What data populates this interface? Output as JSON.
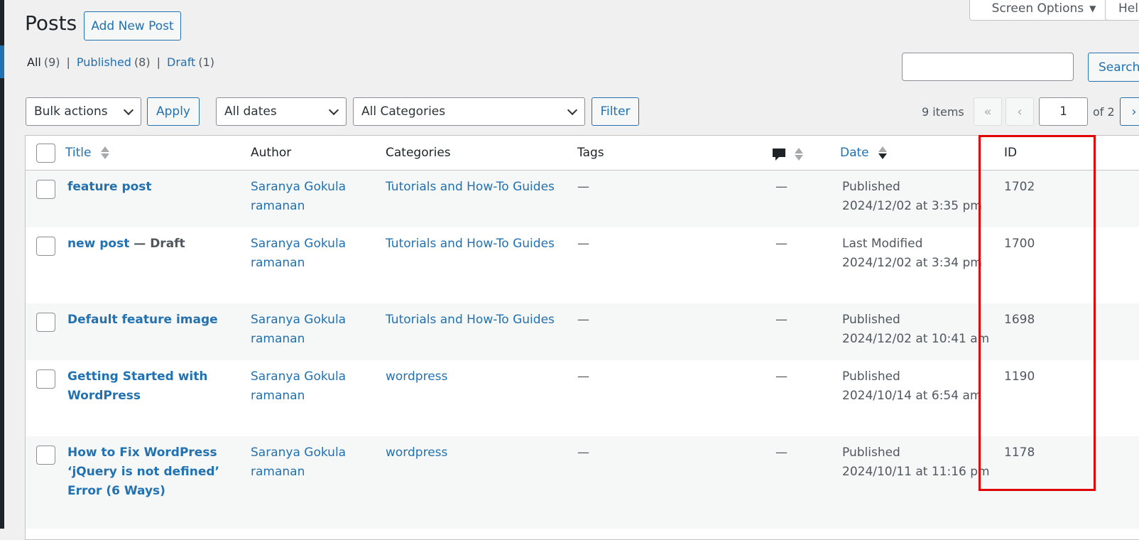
{
  "header": {
    "title": "Posts",
    "add_new_label": "Add New Post",
    "screen_options_label": "Screen Options",
    "help_label": "Help"
  },
  "views": [
    {
      "label": "All",
      "count": "(9)",
      "current": true
    },
    {
      "label": "Published",
      "count": "(8)"
    },
    {
      "label": "Draft",
      "count": "(1)"
    }
  ],
  "search": {
    "value": "",
    "button_label": "Search"
  },
  "filters": {
    "bulk_actions": "Bulk actions",
    "apply_label": "Apply",
    "dates": "All dates",
    "categories": "All Categories",
    "filter_label": "Filter"
  },
  "pagination": {
    "items": "9 items",
    "first": "«",
    "prev": "‹",
    "current_page": "1",
    "of": "of 2",
    "next": "›"
  },
  "columns": {
    "title": "Title",
    "author": "Author",
    "categories": "Categories",
    "tags": "Tags",
    "date": "Date",
    "id": "ID"
  },
  "rows": [
    {
      "title": "feature post",
      "state": "",
      "author": "Saranya Gokula ramanan",
      "category": "Tutorials and How-To Guides",
      "tags": "—",
      "comments": "—",
      "status": "Published",
      "date": "2024/12/02 at 3:35 pm",
      "id": "1702"
    },
    {
      "title": "new post",
      "state": " — Draft",
      "author": "Saranya Gokula ramanan",
      "category": "Tutorials and How-To Guides",
      "tags": "—",
      "comments": "—",
      "status": "Last Modified",
      "date": "2024/12/02 at 3:34 pm",
      "id": "1700"
    },
    {
      "title": "Default feature image",
      "state": "",
      "author": "Saranya Gokula ramanan",
      "category": "Tutorials and How-To Guides",
      "tags": "—",
      "comments": "—",
      "status": "Published",
      "date": "2024/12/02 at 10:41 am",
      "id": "1698"
    },
    {
      "title": "Getting Started with WordPress",
      "state": "",
      "author": "Saranya Gokula ramanan",
      "category": "wordpress",
      "tags": "—",
      "comments": "—",
      "status": "Published",
      "date": "2024/10/14 at 6:54 am",
      "id": "1190"
    },
    {
      "title": "How to Fix WordPress ‘jQuery is not defined’ Error (6 Ways)",
      "state": "",
      "author": "Saranya Gokula ramanan",
      "category": "wordpress",
      "tags": "—",
      "comments": "—",
      "status": "Published",
      "date": "2024/10/11 at 11:16 pm",
      "id": "1178"
    }
  ],
  "colors": {
    "link": "#2271b1",
    "highlight": "#e00000",
    "background": "#f0f0f1"
  }
}
